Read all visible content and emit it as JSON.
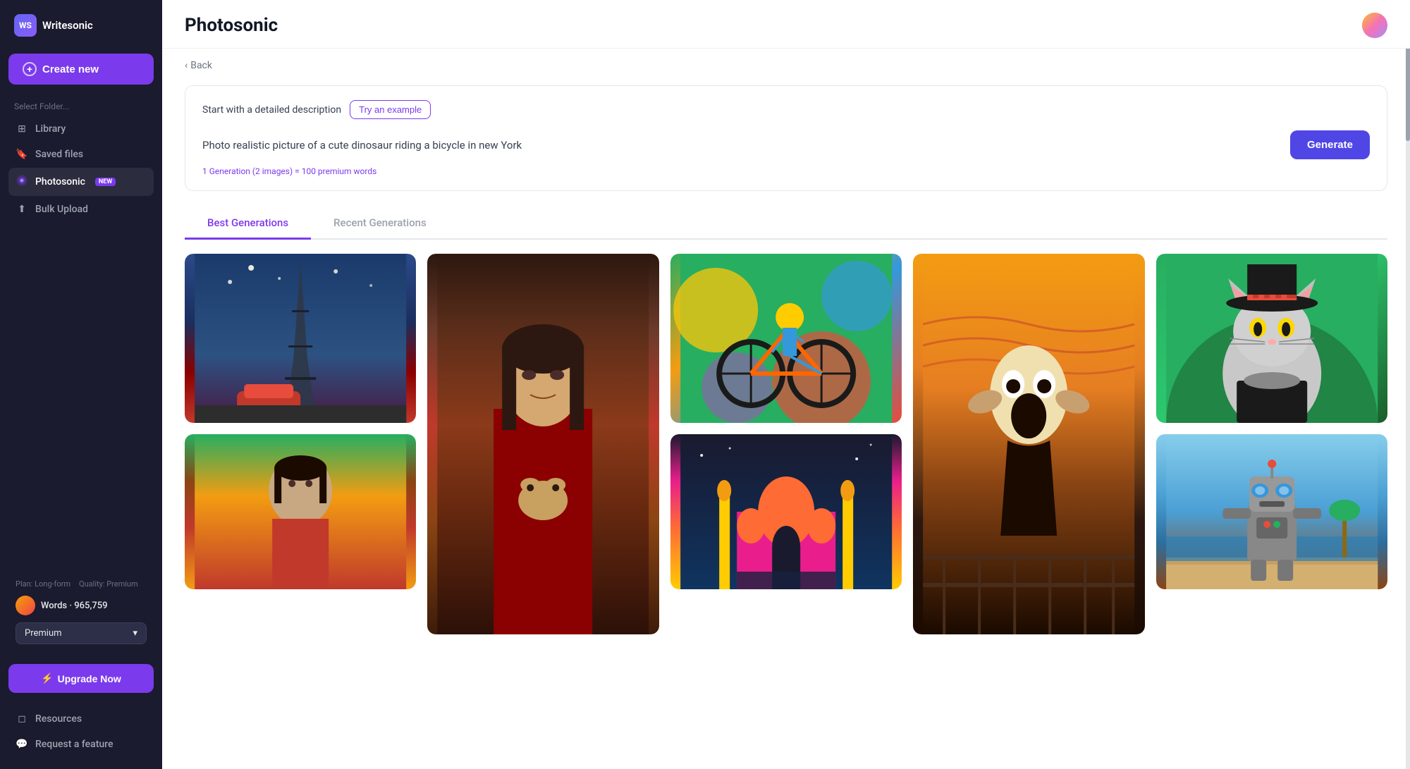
{
  "app": {
    "name": "Writesonic",
    "logo_letters": "WS"
  },
  "sidebar": {
    "create_new_label": "Create new",
    "select_folder_label": "Select Folder...",
    "items": [
      {
        "id": "library",
        "label": "Library",
        "icon": "⊞"
      },
      {
        "id": "saved-files",
        "label": "Saved files",
        "icon": "🔖"
      },
      {
        "id": "photosonic",
        "label": "Photosonic",
        "icon": "🎨",
        "badge": "new",
        "active": true
      },
      {
        "id": "bulk-upload",
        "label": "Bulk Upload",
        "icon": "⬆"
      }
    ],
    "bottom_items": [
      {
        "id": "resources",
        "label": "Resources",
        "icon": "◻"
      },
      {
        "id": "request-feature",
        "label": "Request a feature",
        "icon": "💬"
      }
    ],
    "plan": {
      "plan_label": "Plan: Long-form",
      "quality_label": "Quality: Premium",
      "words_label": "Words",
      "words_count": "965,759",
      "quality_select": "Premium",
      "upgrade_label": "Upgrade Now"
    }
  },
  "header": {
    "title": "Photosonic",
    "back_label": "Back"
  },
  "prompt": {
    "start_label": "Start with a detailed description",
    "try_example_label": "Try an example",
    "placeholder": "Photo realistic picture of a cute dinosaur riding a bicycle in new York",
    "info_text": "1 Generation (2 images) = 100 premium words",
    "generate_label": "Generate"
  },
  "tabs": [
    {
      "id": "best",
      "label": "Best Generations",
      "active": true
    },
    {
      "id": "recent",
      "label": "Recent Generations",
      "active": false
    }
  ],
  "images": {
    "col1": [
      {
        "id": "img-eiffel",
        "alt": "Van Gogh style Eiffel Tower with red car",
        "style": "img-1"
      },
      {
        "id": "img-woman",
        "alt": "Indian woman portrait",
        "style": "img-6"
      }
    ],
    "col2": [
      {
        "id": "img-mona",
        "alt": "Mona Lisa style painting with dog",
        "style": "img-2"
      },
      {
        "id": "img-mona-ext",
        "alt": "Mona Lisa continuation",
        "style": "img-9"
      }
    ],
    "col3": [
      {
        "id": "img-cyclist",
        "alt": "Pop art cyclist on bicycle",
        "style": "img-3"
      },
      {
        "id": "img-taj",
        "alt": "Taj Mahal colorful illustration",
        "style": "img-7"
      }
    ],
    "col4": [
      {
        "id": "img-scream",
        "alt": "Scream style painting on yellow",
        "style": "img-4"
      },
      {
        "id": "img-scream-ext",
        "alt": "Scream bottom",
        "style": "img-10"
      }
    ],
    "col5": [
      {
        "id": "img-cat",
        "alt": "Cat with hat on green background",
        "style": "img-5"
      },
      {
        "id": "img-robot",
        "alt": "Robot on beach",
        "style": "img-8"
      }
    ]
  }
}
